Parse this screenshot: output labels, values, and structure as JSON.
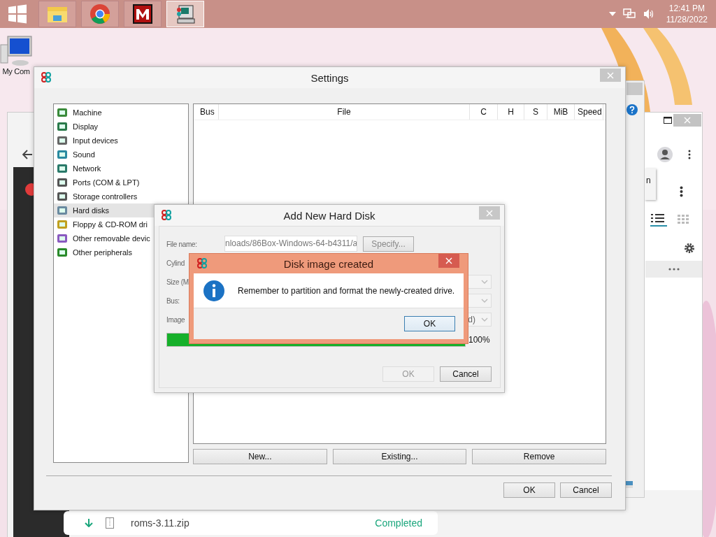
{
  "taskbar": {
    "apps": [
      {
        "kind": "folder",
        "selected": false
      },
      {
        "kind": "chrome",
        "selected": false
      },
      {
        "kind": "m-logo",
        "selected": false
      },
      {
        "kind": "emulator",
        "selected": true
      }
    ],
    "clock": {
      "time": "12:41 PM",
      "date": "11/28/2022"
    }
  },
  "desktop_icons": [
    {
      "label": "My Com"
    }
  ],
  "browser": {
    "popup_text": "n",
    "downloads": [
      {
        "name": "roms-3.11.zip",
        "status": "Completed"
      }
    ]
  },
  "settings": {
    "title": "Settings",
    "categories": [
      {
        "label": "Machine",
        "selected": false
      },
      {
        "label": "Display",
        "selected": false
      },
      {
        "label": "Input devices",
        "selected": false
      },
      {
        "label": "Sound",
        "selected": false
      },
      {
        "label": "Network",
        "selected": false
      },
      {
        "label": "Ports (COM & LPT)",
        "selected": false
      },
      {
        "label": "Storage controllers",
        "selected": false
      },
      {
        "label": "Hard disks",
        "selected": true
      },
      {
        "label": "Floppy & CD-ROM dri",
        "selected": false
      },
      {
        "label": "Other removable devic",
        "selected": false
      },
      {
        "label": "Other peripherals",
        "selected": false
      }
    ],
    "table": {
      "columns": [
        "Bus",
        "File",
        "C",
        "H",
        "S",
        "MiB",
        "Speed"
      ]
    },
    "actions": [
      "New...",
      "Existing...",
      "Remove"
    ],
    "buttons": [
      "OK",
      "Cancel"
    ]
  },
  "add_disk": {
    "title": "Add New Hard Disk",
    "rows": [
      {
        "kind": "file",
        "label": "File name:",
        "value": "nloads/86Box-Windows-64-b4311/a",
        "button": "Specify..."
      },
      {
        "kind": "blank",
        "label": "Cylind"
      },
      {
        "kind": "select",
        "label": "Size (M"
      },
      {
        "kind": "select",
        "label": "Bus:"
      },
      {
        "kind": "select",
        "label": "Image",
        "value": "d)"
      }
    ],
    "progress": {
      "level": 1,
      "reading": "100%"
    },
    "buttons": [
      {
        "label": "OK",
        "disabled": true
      },
      {
        "label": "Cancel",
        "disabled": false
      }
    ]
  },
  "message": {
    "title": "Disk image created",
    "text": "Remember to partition and format the newly-created drive.",
    "button": "OK"
  }
}
